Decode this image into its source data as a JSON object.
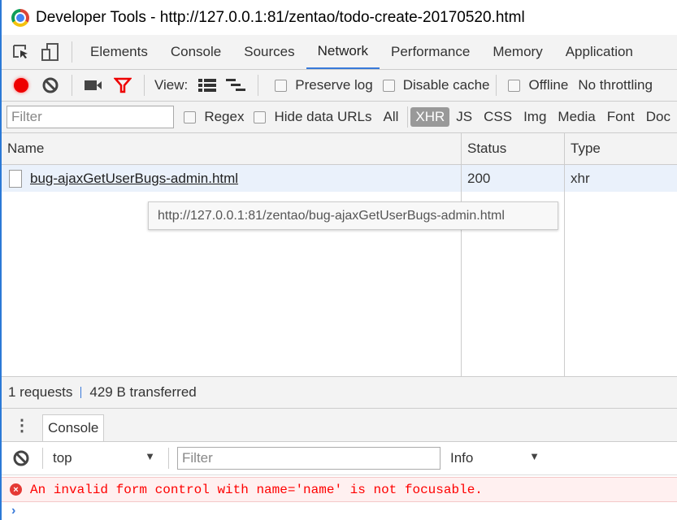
{
  "window": {
    "title": "Developer Tools - http://127.0.0.1:81/zentao/todo-create-20170520.html"
  },
  "tabs": [
    "Elements",
    "Console",
    "Sources",
    "Network",
    "Performance",
    "Memory",
    "Application"
  ],
  "active_tab": "Network",
  "toolbar": {
    "view_label": "View:",
    "preserve_log": "Preserve log",
    "disable_cache": "Disable cache",
    "offline": "Offline",
    "throttle": "No throttling"
  },
  "filterbar": {
    "placeholder": "Filter",
    "regex": "Regex",
    "hide_data_urls": "Hide data URLs",
    "types": [
      "All",
      "XHR",
      "JS",
      "CSS",
      "Img",
      "Media",
      "Font",
      "Doc"
    ],
    "active_type": "XHR"
  },
  "table": {
    "columns": [
      "Name",
      "Status",
      "Type"
    ],
    "rows": [
      {
        "name": "bug-ajaxGetUserBugs-admin.html",
        "status": "200",
        "type": "xhr"
      }
    ]
  },
  "tooltip": "http://127.0.0.1:81/zentao/bug-ajaxGetUserBugs-admin.html",
  "summary": {
    "requests": "1 requests",
    "transferred": "429 B transferred"
  },
  "drawer": {
    "tab": "Console"
  },
  "console": {
    "context": "top",
    "filter_placeholder": "Filter",
    "level": "Info",
    "messages": [
      {
        "level": "error",
        "text": "An invalid form control with name='name' is not focusable."
      }
    ]
  },
  "colors": {
    "accent": "#3879d9",
    "error": "#ff0000",
    "record": "#e00000"
  }
}
